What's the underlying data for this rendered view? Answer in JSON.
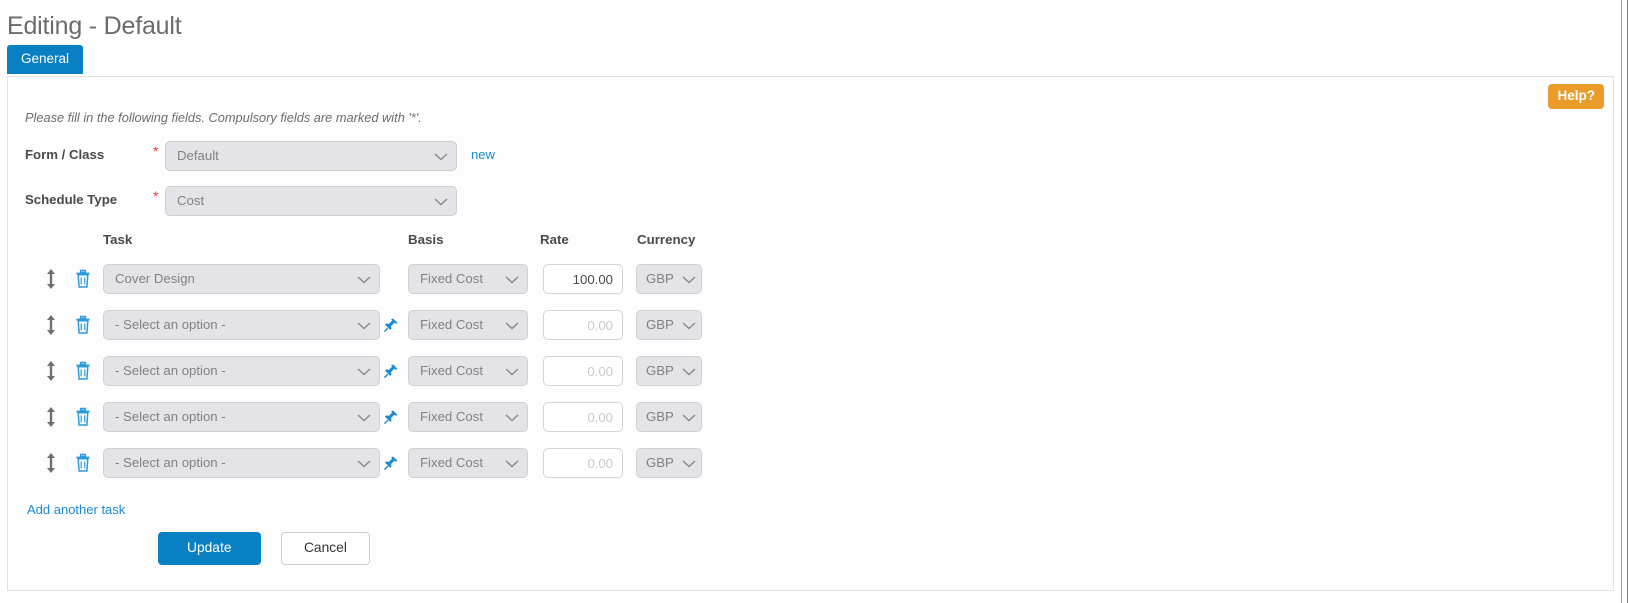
{
  "page": {
    "title": "Editing - Default",
    "help_label": "Help?"
  },
  "tabs": [
    {
      "label": "General",
      "active": true
    }
  ],
  "form": {
    "instructions": "Please fill in the following fields. Compulsory fields are marked with '*'.",
    "required_marker": "*",
    "fields": [
      {
        "label": "Form / Class",
        "required": true,
        "value": "Default",
        "link_label": "new"
      },
      {
        "label": "Schedule Type",
        "required": true,
        "value": "Cost"
      }
    ]
  },
  "task_table": {
    "headers": {
      "task": "Task",
      "basis": "Basis",
      "rate": "Rate",
      "currency": "Currency"
    },
    "rows": [
      {
        "task": "Cover Design",
        "has_pin": false,
        "basis": "Fixed Cost",
        "rate_value": "100.00",
        "rate_placeholder": "0.00",
        "currency": "GBP"
      },
      {
        "task": "- Select an option -",
        "has_pin": true,
        "basis": "Fixed Cost",
        "rate_value": "",
        "rate_placeholder": "0.00",
        "currency": "GBP"
      },
      {
        "task": "- Select an option -",
        "has_pin": true,
        "basis": "Fixed Cost",
        "rate_value": "",
        "rate_placeholder": "0.00",
        "currency": "GBP"
      },
      {
        "task": "- Select an option -",
        "has_pin": true,
        "basis": "Fixed Cost",
        "rate_value": "",
        "rate_placeholder": "0.00",
        "currency": "GBP"
      },
      {
        "task": "- Select an option -",
        "has_pin": true,
        "basis": "Fixed Cost",
        "rate_value": "",
        "rate_placeholder": "0.00",
        "currency": "GBP"
      }
    ],
    "add_label": "Add another task"
  },
  "actions": {
    "update_label": "Update",
    "cancel_label": "Cancel"
  },
  "icons": {
    "drag_handle": "drag-handle-icon",
    "delete": "trash-icon",
    "pin": "pin-icon",
    "caret": "chevron-down-icon"
  },
  "colors": {
    "accent": "#0a80c4",
    "link": "#1b8ad1",
    "help": "#eb9b27",
    "required": "#e03b2f",
    "control_bg": "#e4e4e8"
  }
}
